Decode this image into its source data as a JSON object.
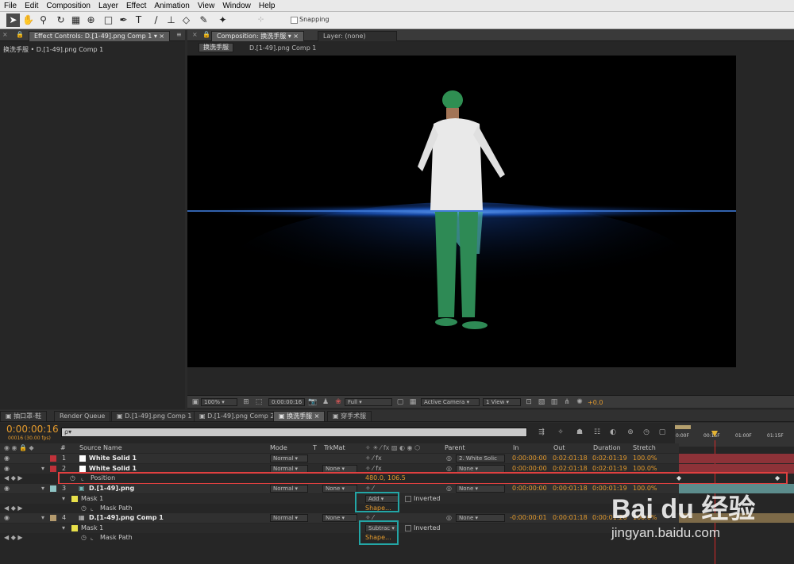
{
  "menu": [
    "File",
    "Edit",
    "Composition",
    "Layer",
    "Effect",
    "Animation",
    "View",
    "Window",
    "Help"
  ],
  "toolbar": {
    "snapping": "Snapping"
  },
  "effect_panel": {
    "tab": "Effect Controls: D.[1-49].png Comp 1",
    "breadcrumb": "换洗手服 • D.[1-49].png Comp 1"
  },
  "comp_panel": {
    "tab": "Composition: 换洗手服",
    "layer_tab": "Layer: (none)",
    "crumb_active": "换洗手服",
    "crumb_other": "D.[1-49].png Comp 1"
  },
  "viewer_bar": {
    "zoom": "100%",
    "timecode": "0:00:00:16",
    "resolution": "Full",
    "camera": "Active Camera",
    "views": "1 View",
    "exposure": "+0.0"
  },
  "bottom_tabs": [
    "抽口罩-鞋",
    "Render Queue",
    "D.[1-49].png Comp 1",
    "D.[1-49].png Comp 2",
    "换洗手服",
    "穿手术服"
  ],
  "timeline": {
    "timecode": "0:00:00:16",
    "frames": "00016 (30.00 fps)",
    "search_placeholder": "ρ▾",
    "headers": {
      "num": "#",
      "source": "Source Name",
      "mode": "Mode",
      "t": "T",
      "trkmat": "TrkMat",
      "parent": "Parent",
      "in": "In",
      "out": "Out",
      "duration": "Duration",
      "stretch": "Stretch"
    },
    "ruler": [
      "0:00F",
      "00:15F",
      "01:00F",
      "01:15F"
    ],
    "layers": [
      {
        "num": "1",
        "name": "White Solid 1",
        "color": "#c0323a",
        "mode": "Normal",
        "trkmat": "",
        "parent": "2. White Solic",
        "in": "0:00:00:00",
        "out": "0:02:01:18",
        "dur": "0:02:01:19",
        "stretch": "100.0%"
      },
      {
        "num": "2",
        "name": "White Solid 1",
        "color": "#c0323a",
        "mode": "Normal",
        "trkmat": "None",
        "parent": "None",
        "in": "0:00:00:00",
        "out": "0:02:01:18",
        "dur": "0:02:01:19",
        "stretch": "100.0%"
      },
      {
        "num": "3",
        "name": "D.[1-49].png",
        "color": "#8fc4c4",
        "mode": "Normal",
        "trkmat": "None",
        "parent": "None",
        "in": "0:00:00:00",
        "out": "0:00:01:18",
        "dur": "0:00:01:19",
        "stretch": "100.0%"
      },
      {
        "num": "4",
        "name": "D.[1-49].png Comp 1",
        "color": "#b49a6e",
        "mode": "Normal",
        "trkmat": "None",
        "parent": "None",
        "in": "-0:00:00:01",
        "out": "0:00:01:18",
        "dur": "0:00:01:20",
        "stretch": "100.0%"
      }
    ],
    "position": {
      "label": "Position",
      "value": "480.0, 106.5"
    },
    "mask1": {
      "label": "Mask 1",
      "mode": "Add",
      "inverted": "Inverted",
      "path": "Mask Path",
      "shape": "Shape..."
    },
    "mask2": {
      "label": "Mask 1",
      "mode": "Subtrac",
      "inverted": "Inverted",
      "path": "Mask Path",
      "shape": "Shape..."
    }
  },
  "watermark": {
    "brand": "Bai du 经验",
    "url": "jingyan.baidu.com"
  },
  "colors": {
    "accent": "#e39a2d",
    "highlight_red": "#e04040",
    "highlight_teal": "#23a6a6"
  }
}
